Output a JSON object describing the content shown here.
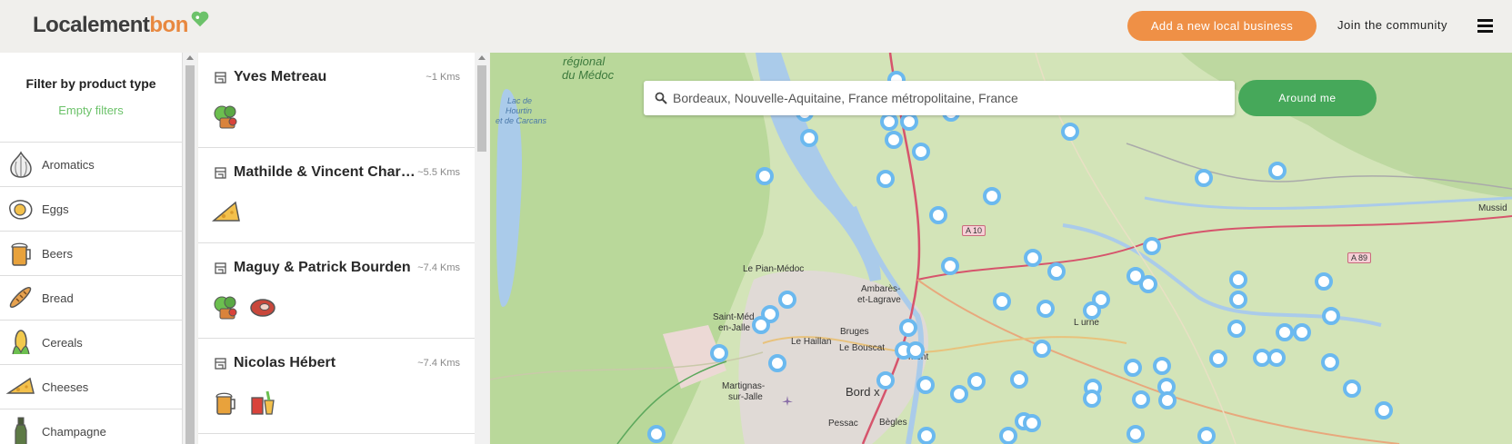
{
  "header": {
    "logo_part1": "Localement",
    "logo_part2": "bon",
    "add_business": "Add a new local business",
    "join": "Join the community",
    "menu_icon": "hamburger-icon"
  },
  "filters": {
    "title": "Filter by product type",
    "empty": "Empty filters",
    "categories": [
      {
        "label": "Aromatics",
        "icon": "garlic-icon"
      },
      {
        "label": "Eggs",
        "icon": "egg-icon"
      },
      {
        "label": "Beers",
        "icon": "beer-icon"
      },
      {
        "label": "Bread",
        "icon": "bread-icon"
      },
      {
        "label": "Cereals",
        "icon": "corn-icon"
      },
      {
        "label": "Cheeses",
        "icon": "cheese-icon"
      },
      {
        "label": "Champagne",
        "icon": "champagne-icon"
      }
    ]
  },
  "businesses": [
    {
      "name": "Yves Metreau",
      "distance": "~1 Kms",
      "products": [
        "vegetables-icon"
      ]
    },
    {
      "name": "Mathilde & Vincent Charl...",
      "distance": "~5.5 Kms",
      "products": [
        "cheese-icon"
      ]
    },
    {
      "name": "Maguy & Patrick Bourden",
      "distance": "~7.4 Kms",
      "products": [
        "vegetables-icon",
        "meat-icon"
      ]
    },
    {
      "name": "Nicolas Hébert",
      "distance": "~7.4 Kms",
      "products": [
        "beer-icon",
        "juice-icon"
      ]
    }
  ],
  "map": {
    "search_value": "Bordeaux, Nouvelle-Aquitaine, France métropolitaine, France",
    "around_me": "Around me",
    "labels": {
      "regional": "régional",
      "medoc": "du Médoc",
      "lac1": "Lac de",
      "lac2": "Hourtin",
      "lac3": "et de Carcans",
      "pian": "Le Pian-Médoc",
      "ambares1": "Ambarès-",
      "ambares2": "et-Lagrave",
      "saintmed1": "Saint-Méd",
      "saintmed2": "en-Jalle",
      "haillan": "Le Haillan",
      "bruges": "Bruges",
      "bouscat": "Le Bouscat",
      "bordeaux": "Bord  x",
      "martignas1": "Martignas-",
      "martignas2": "sur-Jalle",
      "pessac": "Pessac",
      "begles": "Bègles",
      "libourne": "L  urne",
      "mont": "  mont",
      "mussid": "Mussid"
    },
    "roads": {
      "a10": "A 10",
      "a89": "A 89"
    }
  },
  "colors": {
    "accent_orange": "#ef9046",
    "accent_green": "#46a85a",
    "filter_green": "#6cc26a",
    "pin_blue": "#6bb9ef"
  }
}
